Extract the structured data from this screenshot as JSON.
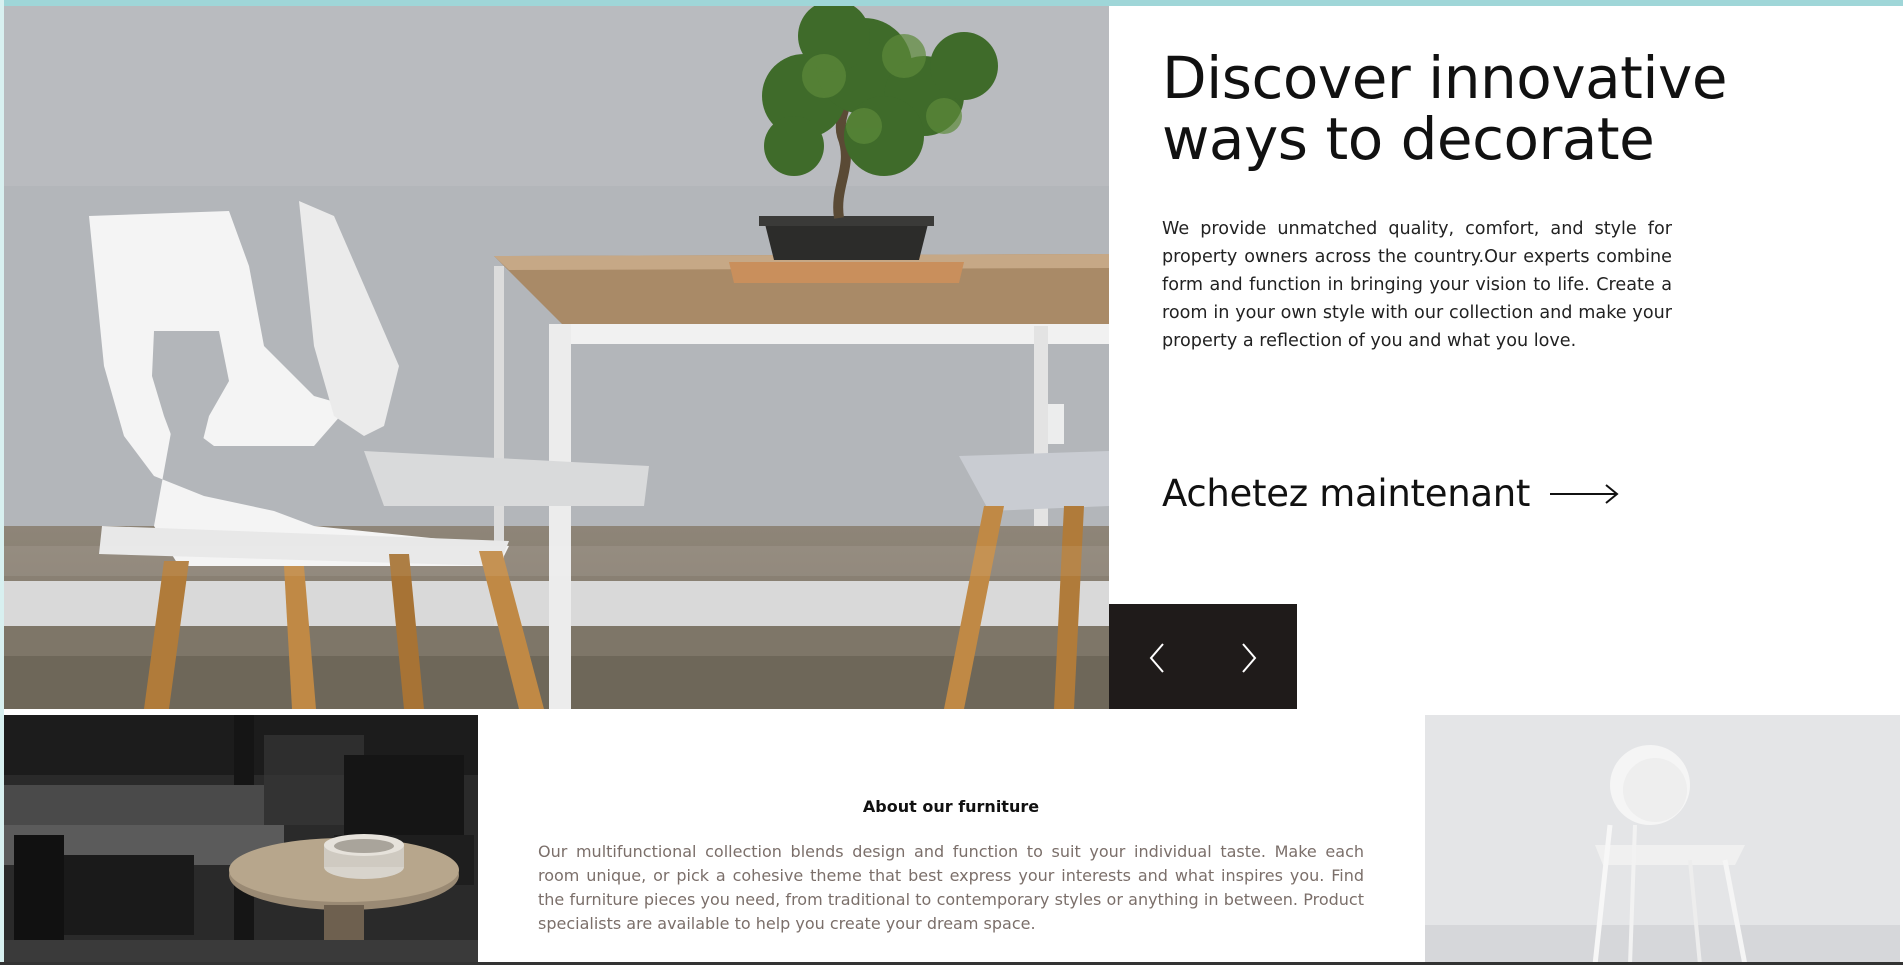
{
  "hero": {
    "image_name": "dining-table-with-chairs-and-bonsai",
    "title": "Discover innovative ways to decorate",
    "description": "We provide unmatched quality, comfort, and style for property owners across the country.Our experts combine form and function in bringing your vision to life. Create a room in your own style with our collection and make your property a reflection of you and what you love.",
    "cta_label": "Achetez maintenant",
    "cta_icon": "arrow-right-icon"
  },
  "slider": {
    "prev_icon": "chevron-left-icon",
    "next_icon": "chevron-right-icon",
    "background": "#1f1b1a"
  },
  "about": {
    "title": "About our furniture",
    "description": "Our multifunctional collection blends design and function to suit your individual taste. Make each room unique, or pick a cohesive theme that best express your interests and what inspires you. Find the furniture pieces you need, from traditional to contemporary styles or anything in between. Product specialists are available to help you create your dream space.",
    "left_image": "dark-living-room-with-armchairs-and-coffee-table",
    "right_image": "white-chair-against-light-wall"
  },
  "colors": {
    "accent_top": "#9fd6d8",
    "text_primary": "#111111",
    "text_muted": "#7b6f6a"
  }
}
